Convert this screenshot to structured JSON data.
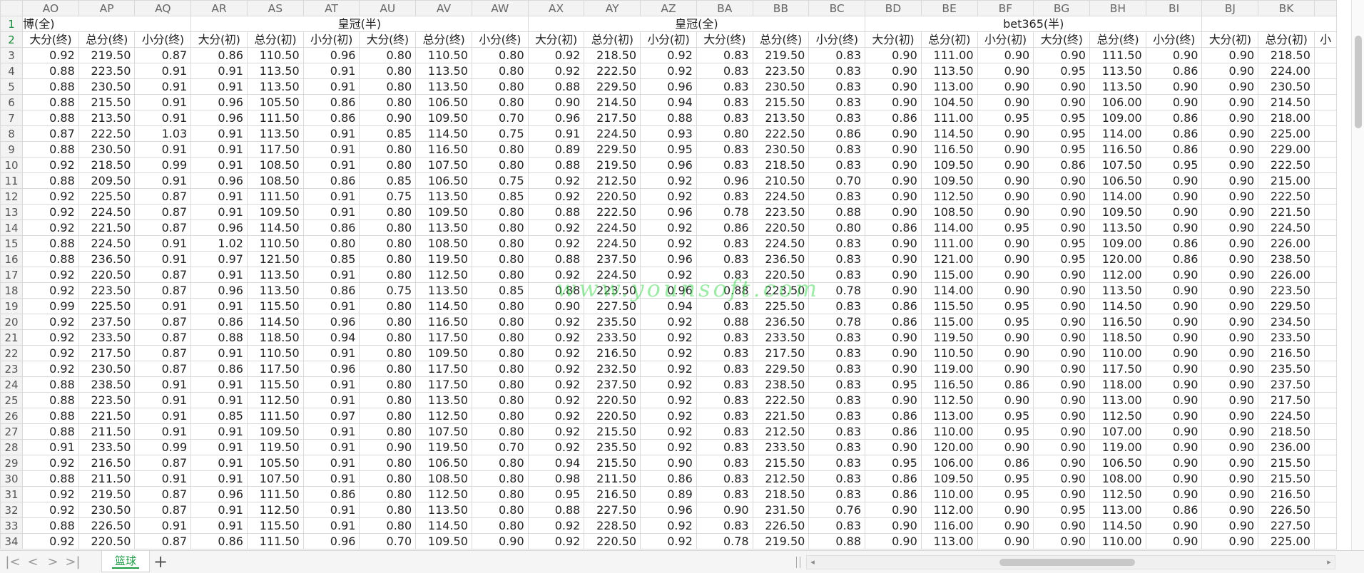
{
  "columns": [
    "AO",
    "AP",
    "AQ",
    "AR",
    "AS",
    "AT",
    "AU",
    "AV",
    "AW",
    "AX",
    "AY",
    "AZ",
    "BA",
    "BB",
    "BC",
    "BD",
    "BE",
    "BF",
    "BG",
    "BH",
    "BI",
    "BJ",
    "BK",
    ""
  ],
  "row1": {
    "num": "1",
    "groups": [
      {
        "label": "博(全)",
        "span": 3,
        "cls": "grp0"
      },
      {
        "label": "皇冠(半)",
        "span": 6,
        "cls": "grp"
      },
      {
        "label": "皇冠(全)",
        "span": 6,
        "cls": "grp"
      },
      {
        "label": "bet365(半)",
        "span": 6,
        "cls": "grp"
      },
      {
        "label": "",
        "span": 3,
        "cls": "grp"
      }
    ]
  },
  "row2": {
    "num": "2",
    "headers": [
      "大分(终)",
      "总分(终)",
      "小分(终)",
      "大分(初)",
      "总分(初)",
      "小分(初)",
      "大分(终)",
      "总分(终)",
      "小分(终)",
      "大分(初)",
      "总分(初)",
      "小分(初)",
      "大分(终)",
      "总分(终)",
      "小分(终)",
      "大分(初)",
      "总分(初)",
      "小分(初)",
      "大分(终)",
      "总分(终)",
      "小分(终)",
      "大分(初)",
      "总分(初)",
      "小"
    ]
  },
  "rows": [
    {
      "num": "3",
      "cells": [
        "0.92",
        "219.50",
        "0.87",
        "0.86",
        "110.50",
        "0.96",
        "0.80",
        "110.50",
        "0.80",
        "0.92",
        "218.50",
        "0.92",
        "0.83",
        "219.50",
        "0.83",
        "0.90",
        "111.00",
        "0.90",
        "0.90",
        "111.50",
        "0.90",
        "0.90",
        "218.50",
        ""
      ]
    },
    {
      "num": "4",
      "cells": [
        "0.88",
        "223.50",
        "0.91",
        "0.91",
        "113.50",
        "0.91",
        "0.80",
        "113.50",
        "0.80",
        "0.92",
        "222.50",
        "0.92",
        "0.83",
        "223.50",
        "0.83",
        "0.90",
        "113.50",
        "0.90",
        "0.95",
        "113.50",
        "0.86",
        "0.90",
        "224.00",
        ""
      ]
    },
    {
      "num": "5",
      "cells": [
        "0.88",
        "230.50",
        "0.91",
        "0.91",
        "113.50",
        "0.91",
        "0.80",
        "113.50",
        "0.80",
        "0.88",
        "229.50",
        "0.96",
        "0.83",
        "230.50",
        "0.83",
        "0.90",
        "113.00",
        "0.90",
        "0.90",
        "113.50",
        "0.90",
        "0.90",
        "230.50",
        ""
      ]
    },
    {
      "num": "6",
      "cells": [
        "0.88",
        "215.50",
        "0.91",
        "0.96",
        "105.50",
        "0.86",
        "0.80",
        "106.50",
        "0.80",
        "0.90",
        "214.50",
        "0.94",
        "0.83",
        "215.50",
        "0.83",
        "0.90",
        "104.50",
        "0.90",
        "0.90",
        "106.00",
        "0.90",
        "0.90",
        "214.50",
        ""
      ]
    },
    {
      "num": "7",
      "cells": [
        "0.88",
        "213.50",
        "0.91",
        "0.96",
        "111.50",
        "0.86",
        "0.90",
        "109.50",
        "0.70",
        "0.96",
        "217.50",
        "0.88",
        "0.83",
        "213.50",
        "0.83",
        "0.86",
        "111.00",
        "0.95",
        "0.95",
        "109.00",
        "0.86",
        "0.90",
        "218.00",
        ""
      ]
    },
    {
      "num": "8",
      "cells": [
        "0.87",
        "222.50",
        "1.03",
        "0.91",
        "113.50",
        "0.91",
        "0.85",
        "114.50",
        "0.75",
        "0.91",
        "224.50",
        "0.93",
        "0.80",
        "222.50",
        "0.86",
        "0.90",
        "114.50",
        "0.90",
        "0.95",
        "114.00",
        "0.86",
        "0.90",
        "225.00",
        ""
      ]
    },
    {
      "num": "9",
      "cells": [
        "0.88",
        "230.50",
        "0.91",
        "0.91",
        "117.50",
        "0.91",
        "0.80",
        "116.50",
        "0.80",
        "0.89",
        "229.50",
        "0.95",
        "0.83",
        "230.50",
        "0.83",
        "0.90",
        "116.50",
        "0.90",
        "0.95",
        "116.50",
        "0.86",
        "0.90",
        "229.00",
        ""
      ]
    },
    {
      "num": "10",
      "cells": [
        "0.92",
        "218.50",
        "0.99",
        "0.91",
        "108.50",
        "0.91",
        "0.80",
        "107.50",
        "0.80",
        "0.88",
        "219.50",
        "0.96",
        "0.83",
        "218.50",
        "0.83",
        "0.90",
        "109.50",
        "0.90",
        "0.86",
        "107.50",
        "0.95",
        "0.90",
        "222.50",
        ""
      ]
    },
    {
      "num": "11",
      "cells": [
        "0.88",
        "209.50",
        "0.91",
        "0.96",
        "108.50",
        "0.86",
        "0.85",
        "106.50",
        "0.75",
        "0.92",
        "212.50",
        "0.92",
        "0.96",
        "210.50",
        "0.70",
        "0.90",
        "109.50",
        "0.90",
        "0.90",
        "106.50",
        "0.90",
        "0.90",
        "215.00",
        ""
      ]
    },
    {
      "num": "12",
      "cells": [
        "0.92",
        "225.50",
        "0.87",
        "0.91",
        "111.50",
        "0.91",
        "0.75",
        "113.50",
        "0.85",
        "0.92",
        "220.50",
        "0.92",
        "0.83",
        "224.50",
        "0.83",
        "0.90",
        "112.50",
        "0.90",
        "0.90",
        "114.00",
        "0.90",
        "0.90",
        "222.50",
        ""
      ]
    },
    {
      "num": "13",
      "cells": [
        "0.92",
        "224.50",
        "0.87",
        "0.91",
        "109.50",
        "0.91",
        "0.80",
        "109.50",
        "0.80",
        "0.88",
        "222.50",
        "0.96",
        "0.78",
        "223.50",
        "0.88",
        "0.90",
        "108.50",
        "0.90",
        "0.90",
        "109.50",
        "0.90",
        "0.90",
        "221.50",
        ""
      ]
    },
    {
      "num": "14",
      "cells": [
        "0.92",
        "221.50",
        "0.87",
        "0.96",
        "114.50",
        "0.86",
        "0.80",
        "113.50",
        "0.80",
        "0.92",
        "224.50",
        "0.92",
        "0.86",
        "220.50",
        "0.80",
        "0.86",
        "114.00",
        "0.95",
        "0.90",
        "113.50",
        "0.90",
        "0.90",
        "224.50",
        ""
      ]
    },
    {
      "num": "15",
      "cells": [
        "0.88",
        "224.50",
        "0.91",
        "1.02",
        "110.50",
        "0.80",
        "0.80",
        "108.50",
        "0.80",
        "0.92",
        "224.50",
        "0.92",
        "0.83",
        "224.50",
        "0.83",
        "0.90",
        "111.00",
        "0.90",
        "0.95",
        "109.00",
        "0.86",
        "0.90",
        "226.00",
        ""
      ]
    },
    {
      "num": "16",
      "cells": [
        "0.88",
        "236.50",
        "0.91",
        "0.97",
        "121.50",
        "0.85",
        "0.80",
        "119.50",
        "0.80",
        "0.88",
        "237.50",
        "0.96",
        "0.83",
        "236.50",
        "0.83",
        "0.90",
        "121.00",
        "0.90",
        "0.95",
        "120.00",
        "0.86",
        "0.90",
        "238.50",
        ""
      ]
    },
    {
      "num": "17",
      "cells": [
        "0.92",
        "220.50",
        "0.87",
        "0.91",
        "113.50",
        "0.91",
        "0.80",
        "112.50",
        "0.80",
        "0.92",
        "224.50",
        "0.92",
        "0.83",
        "220.50",
        "0.83",
        "0.90",
        "115.00",
        "0.90",
        "0.90",
        "112.00",
        "0.90",
        "0.90",
        "226.00",
        ""
      ]
    },
    {
      "num": "18",
      "cells": [
        "0.92",
        "223.50",
        "0.87",
        "0.96",
        "113.50",
        "0.86",
        "0.75",
        "113.50",
        "0.85",
        "0.88",
        "223.50",
        "0.96",
        "0.88",
        "223.50",
        "0.78",
        "0.90",
        "114.00",
        "0.90",
        "0.90",
        "113.50",
        "0.90",
        "0.90",
        "223.50",
        ""
      ]
    },
    {
      "num": "19",
      "cells": [
        "0.99",
        "225.50",
        "0.91",
        "0.91",
        "115.50",
        "0.91",
        "0.80",
        "114.50",
        "0.80",
        "0.90",
        "227.50",
        "0.94",
        "0.83",
        "225.50",
        "0.83",
        "0.86",
        "115.50",
        "0.95",
        "0.90",
        "114.50",
        "0.90",
        "0.90",
        "229.50",
        ""
      ]
    },
    {
      "num": "20",
      "cells": [
        "0.92",
        "237.50",
        "0.87",
        "0.86",
        "114.50",
        "0.96",
        "0.80",
        "116.50",
        "0.80",
        "0.92",
        "235.50",
        "0.92",
        "0.88",
        "236.50",
        "0.78",
        "0.86",
        "115.00",
        "0.95",
        "0.90",
        "116.50",
        "0.90",
        "0.90",
        "234.50",
        ""
      ]
    },
    {
      "num": "21",
      "cells": [
        "0.92",
        "233.50",
        "0.87",
        "0.88",
        "118.50",
        "0.94",
        "0.80",
        "117.50",
        "0.80",
        "0.92",
        "233.50",
        "0.92",
        "0.83",
        "233.50",
        "0.83",
        "0.90",
        "119.50",
        "0.90",
        "0.90",
        "118.50",
        "0.90",
        "0.90",
        "233.50",
        ""
      ]
    },
    {
      "num": "22",
      "cells": [
        "0.92",
        "217.50",
        "0.87",
        "0.91",
        "110.50",
        "0.91",
        "0.80",
        "109.50",
        "0.80",
        "0.92",
        "216.50",
        "0.92",
        "0.83",
        "217.50",
        "0.83",
        "0.90",
        "110.50",
        "0.90",
        "0.90",
        "110.00",
        "0.90",
        "0.90",
        "216.50",
        ""
      ]
    },
    {
      "num": "23",
      "cells": [
        "0.92",
        "230.50",
        "0.87",
        "0.86",
        "117.50",
        "0.96",
        "0.80",
        "117.50",
        "0.80",
        "0.92",
        "232.50",
        "0.92",
        "0.83",
        "229.50",
        "0.83",
        "0.90",
        "119.00",
        "0.90",
        "0.90",
        "117.50",
        "0.90",
        "0.90",
        "235.50",
        ""
      ]
    },
    {
      "num": "24",
      "cells": [
        "0.88",
        "238.50",
        "0.91",
        "0.91",
        "115.50",
        "0.91",
        "0.80",
        "117.50",
        "0.80",
        "0.92",
        "237.50",
        "0.92",
        "0.83",
        "238.50",
        "0.83",
        "0.95",
        "116.50",
        "0.86",
        "0.90",
        "118.00",
        "0.90",
        "0.90",
        "237.50",
        ""
      ]
    },
    {
      "num": "25",
      "cells": [
        "0.88",
        "223.50",
        "0.91",
        "0.91",
        "112.50",
        "0.91",
        "0.80",
        "113.50",
        "0.80",
        "0.92",
        "220.50",
        "0.92",
        "0.83",
        "222.50",
        "0.83",
        "0.90",
        "112.50",
        "0.90",
        "0.90",
        "113.00",
        "0.90",
        "0.90",
        "217.50",
        ""
      ]
    },
    {
      "num": "26",
      "cells": [
        "0.88",
        "221.50",
        "0.91",
        "0.85",
        "111.50",
        "0.97",
        "0.80",
        "112.50",
        "0.80",
        "0.92",
        "220.50",
        "0.92",
        "0.83",
        "221.50",
        "0.83",
        "0.86",
        "113.00",
        "0.95",
        "0.90",
        "112.50",
        "0.90",
        "0.90",
        "224.50",
        ""
      ]
    },
    {
      "num": "27",
      "cells": [
        "0.88",
        "211.50",
        "0.91",
        "0.91",
        "109.50",
        "0.91",
        "0.80",
        "107.50",
        "0.80",
        "0.92",
        "215.50",
        "0.92",
        "0.83",
        "212.50",
        "0.83",
        "0.86",
        "110.00",
        "0.95",
        "0.90",
        "107.00",
        "0.90",
        "0.90",
        "218.50",
        ""
      ]
    },
    {
      "num": "28",
      "cells": [
        "0.91",
        "233.50",
        "0.99",
        "0.91",
        "119.50",
        "0.91",
        "0.90",
        "119.50",
        "0.70",
        "0.92",
        "235.50",
        "0.92",
        "0.83",
        "233.50",
        "0.83",
        "0.90",
        "120.00",
        "0.90",
        "0.90",
        "119.00",
        "0.90",
        "0.90",
        "236.00",
        ""
      ]
    },
    {
      "num": "29",
      "cells": [
        "0.92",
        "216.50",
        "0.87",
        "0.91",
        "105.50",
        "0.91",
        "0.80",
        "106.50",
        "0.80",
        "0.94",
        "215.50",
        "0.90",
        "0.83",
        "215.50",
        "0.83",
        "0.95",
        "106.00",
        "0.86",
        "0.90",
        "106.50",
        "0.90",
        "0.90",
        "215.50",
        ""
      ]
    },
    {
      "num": "30",
      "cells": [
        "0.88",
        "211.50",
        "0.91",
        "0.91",
        "107.50",
        "0.91",
        "0.80",
        "108.50",
        "0.80",
        "0.98",
        "211.50",
        "0.86",
        "0.83",
        "212.50",
        "0.83",
        "0.86",
        "109.50",
        "0.95",
        "0.90",
        "108.00",
        "0.90",
        "0.90",
        "215.50",
        ""
      ]
    },
    {
      "num": "31",
      "cells": [
        "0.92",
        "219.50",
        "0.87",
        "0.96",
        "111.50",
        "0.86",
        "0.80",
        "112.50",
        "0.80",
        "0.95",
        "216.50",
        "0.89",
        "0.83",
        "218.50",
        "0.83",
        "0.86",
        "110.00",
        "0.95",
        "0.90",
        "112.50",
        "0.90",
        "0.90",
        "216.50",
        ""
      ]
    },
    {
      "num": "32",
      "cells": [
        "0.92",
        "230.50",
        "0.87",
        "0.91",
        "112.50",
        "0.91",
        "0.80",
        "113.50",
        "0.80",
        "0.88",
        "227.50",
        "0.96",
        "0.90",
        "231.50",
        "0.76",
        "0.90",
        "112.00",
        "0.90",
        "0.95",
        "113.00",
        "0.86",
        "0.90",
        "226.50",
        ""
      ]
    },
    {
      "num": "33",
      "cells": [
        "0.88",
        "226.50",
        "0.91",
        "0.91",
        "115.50",
        "0.91",
        "0.80",
        "114.50",
        "0.80",
        "0.92",
        "228.50",
        "0.92",
        "0.83",
        "226.50",
        "0.83",
        "0.90",
        "116.00",
        "0.90",
        "0.90",
        "114.50",
        "0.90",
        "0.90",
        "227.50",
        ""
      ]
    },
    {
      "num": "34",
      "cells": [
        "0.92",
        "220.50",
        "0.87",
        "0.86",
        "111.50",
        "0.96",
        "0.70",
        "109.50",
        "0.90",
        "0.92",
        "220.50",
        "0.92",
        "0.78",
        "219.50",
        "0.88",
        "0.90",
        "113.00",
        "0.90",
        "0.90",
        "110.00",
        "0.90",
        "0.90",
        "225.00",
        ""
      ]
    }
  ],
  "watermark": "www.younsoft.com",
  "sheet_tab": "篮球",
  "nav": {
    "first": "|<",
    "prev": "<",
    "next": ">",
    "last": ">|",
    "add": "+",
    "left_arrow": "◂",
    "right_arrow": "▸"
  },
  "colors": {
    "accent": "#1f9d45",
    "grid": "#d9d9d9",
    "header_bg": "#f3f3f3",
    "watermark": "#28d23c"
  }
}
